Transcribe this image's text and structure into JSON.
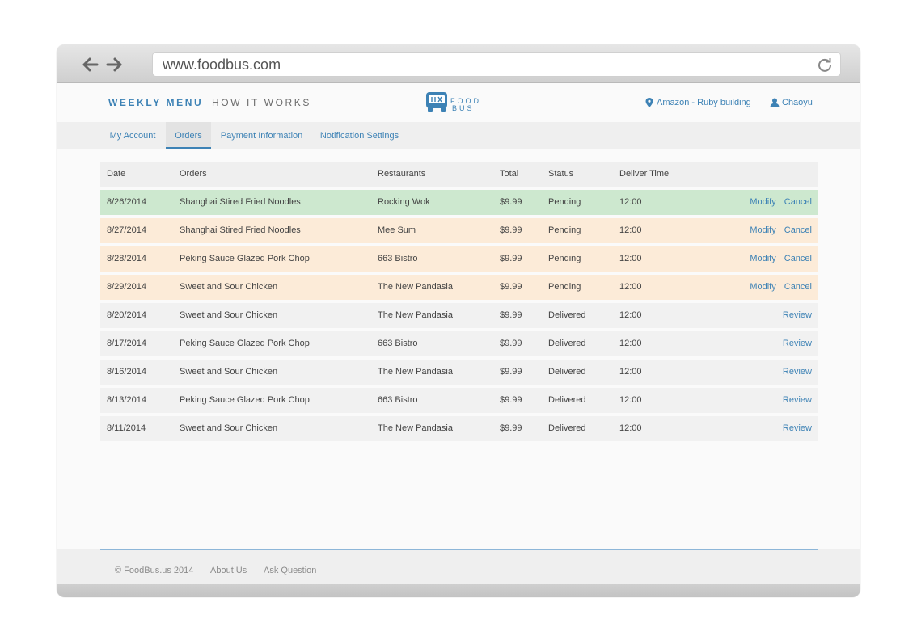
{
  "browser": {
    "url": "www.foodbus.com",
    "icons": {
      "back": "arrow-left-icon",
      "forward": "arrow-right-icon",
      "reload": "reload-icon"
    }
  },
  "header": {
    "nav": {
      "weekly_menu": "WEEKLY MENU",
      "how_it_works": "HOW IT WORKS"
    },
    "logo_text": {
      "line1": "FOOD",
      "line2": "BUS"
    },
    "location": "Amazon - Ruby building",
    "user": "Chaoyu"
  },
  "subnav": {
    "tabs": [
      {
        "label": "My Account",
        "active": false
      },
      {
        "label": "Orders",
        "active": true
      },
      {
        "label": "Payment Information",
        "active": false
      },
      {
        "label": "Notification Settings",
        "active": false
      }
    ]
  },
  "table": {
    "headers": {
      "date": "Date",
      "orders": "Orders",
      "restaurants": "Restaurants",
      "total": "Total",
      "status": "Status",
      "deliver_time": "Deliver Time"
    },
    "rows": [
      {
        "date": "8/26/2014",
        "order": "Shanghai Stired Fried Noodles",
        "restaurant": "Rocking Wok",
        "total": "$9.99",
        "status": "Pending",
        "time": "12:00",
        "action1": "Modify",
        "action2": "Cancel"
      },
      {
        "date": "8/27/2014",
        "order": "Shanghai Stired Fried Noodles",
        "restaurant": "Mee Sum",
        "total": "$9.99",
        "status": "Pending",
        "time": "12:00",
        "action1": "Modify",
        "action2": "Cancel"
      },
      {
        "date": "8/28/2014",
        "order": "Peking Sauce Glazed Pork Chop",
        "restaurant": "663 Bistro",
        "total": "$9.99",
        "status": "Pending",
        "time": "12:00",
        "action1": "Modify",
        "action2": "Cancel"
      },
      {
        "date": "8/29/2014",
        "order": "Sweet and Sour Chicken",
        "restaurant": "The New Pandasia",
        "total": "$9.99",
        "status": "Pending",
        "time": "12:00",
        "action1": "Modify",
        "action2": "Cancel"
      },
      {
        "date": "8/20/2014",
        "order": "Sweet and Sour Chicken",
        "restaurant": "The New Pandasia",
        "total": "$9.99",
        "status": "Delivered",
        "time": "12:00",
        "action1": "Review"
      },
      {
        "date": "8/17/2014",
        "order": "Peking Sauce Glazed Pork Chop",
        "restaurant": "663 Bistro",
        "total": "$9.99",
        "status": "Delivered",
        "time": "12:00",
        "action1": "Review"
      },
      {
        "date": "8/16/2014",
        "order": "Sweet and Sour Chicken",
        "restaurant": "The New Pandasia",
        "total": "$9.99",
        "status": "Delivered",
        "time": "12:00",
        "action1": "Review"
      },
      {
        "date": "8/13/2014",
        "order": "Peking Sauce Glazed Pork Chop",
        "restaurant": "663 Bistro",
        "total": "$9.99",
        "status": "Delivered",
        "time": "12:00",
        "action1": "Review"
      },
      {
        "date": "8/11/2014",
        "order": "Sweet and Sour Chicken",
        "restaurant": "The New Pandasia",
        "total": "$9.99",
        "status": "Delivered",
        "time": "12:00",
        "action1": "Review"
      }
    ]
  },
  "footer": {
    "copyright": "© FoodBus.us 2014",
    "about": "About Us",
    "ask": "Ask Question"
  },
  "colors": {
    "accent": "#3d82b5",
    "row_highlight": "#cde8cf",
    "row_pending": "#fcebd8",
    "row_delivered": "#f1f1f1"
  }
}
